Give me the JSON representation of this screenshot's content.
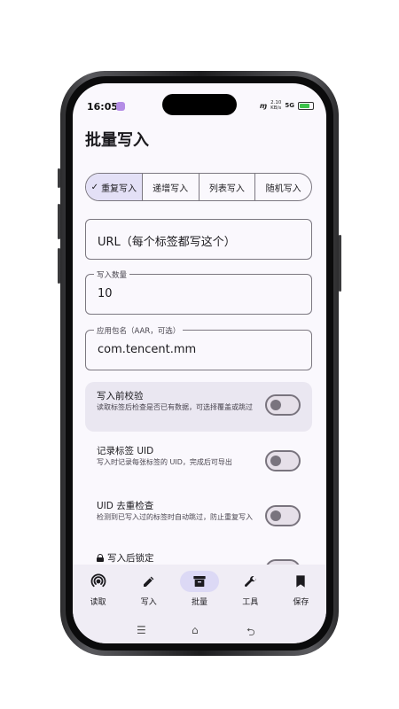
{
  "status_bar": {
    "time": "16:05",
    "net_speed_top": "2.10",
    "net_speed_bottom": "KB/s",
    "signal": "5G"
  },
  "header": {
    "title": "批量写入"
  },
  "modes": [
    {
      "label": "重复写入",
      "selected": true
    },
    {
      "label": "递增写入",
      "selected": false
    },
    {
      "label": "列表写入",
      "selected": false
    },
    {
      "label": "随机写入",
      "selected": false
    }
  ],
  "fields": {
    "url": {
      "placeholder": "URL（每个标签都写这个）"
    },
    "count": {
      "label": "写入数量",
      "value": "10"
    },
    "package": {
      "label": "应用包名（AAR，可选）",
      "value": "com.tencent.mm"
    }
  },
  "settings": [
    {
      "title": "写入前校验",
      "desc": "读取标签后检查是否已有数据，可选择覆盖或跳过",
      "on": false
    },
    {
      "title": "记录标签 UID",
      "desc": "写入时记录每张标签的 UID，完成后可导出",
      "on": false
    },
    {
      "title": "UID 去重检查",
      "desc": "检测到已写入过的标签时自动跳过，防止重复写入",
      "on": false
    },
    {
      "title": "写入后锁定",
      "on": false
    }
  ],
  "nav": [
    {
      "label": "读取",
      "icon": "nfc-icon",
      "active": false
    },
    {
      "label": "写入",
      "icon": "pencil-icon",
      "active": false
    },
    {
      "label": "批量",
      "icon": "archive-box-icon",
      "active": true
    },
    {
      "label": "工具",
      "icon": "wrench-icon",
      "active": false
    },
    {
      "label": "保存",
      "icon": "bookmark-icon",
      "active": false
    }
  ],
  "colors": {
    "accent_container": "#dcd9f5",
    "selected_segment": "#e3e0f6",
    "highlight_row": "#eae7f1",
    "battery": "#3cc24a"
  }
}
